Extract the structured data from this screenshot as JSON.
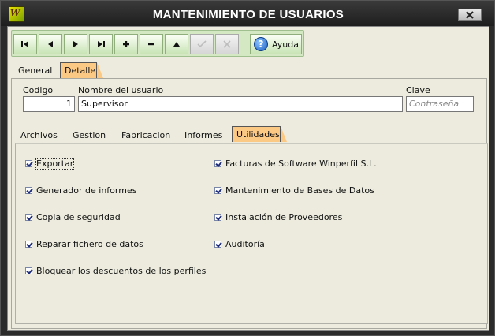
{
  "window": {
    "title": "MANTENIMIENTO DE USUARIOS",
    "app_icon_text": "W"
  },
  "toolbar": {
    "ayuda_label": "Ayuda"
  },
  "main_tabs": [
    {
      "label": "General",
      "active": false
    },
    {
      "label": "Detalle",
      "active": true
    }
  ],
  "form": {
    "codigo_label": "Codigo",
    "codigo_value": "1",
    "nombre_label": "Nombre del usuario",
    "nombre_value": "Supervisor",
    "clave_label": "Clave",
    "clave_placeholder": "Contraseña"
  },
  "sub_tabs": [
    {
      "label": "Archivos",
      "active": false
    },
    {
      "label": "Gestion",
      "active": false
    },
    {
      "label": "Fabricacion",
      "active": false
    },
    {
      "label": "Informes",
      "active": false
    },
    {
      "label": "Utilidades",
      "active": true
    }
  ],
  "permissions_left": [
    {
      "label": "Exportar",
      "checked": true
    },
    {
      "label": "Generador de informes",
      "checked": true
    },
    {
      "label": "Copia de seguridad",
      "checked": true
    },
    {
      "label": "Reparar fichero de datos",
      "checked": true
    },
    {
      "label": "Bloquear los descuentos de los perfiles",
      "checked": true
    }
  ],
  "permissions_right": [
    {
      "label": "Facturas de Software Winperfil S.L.",
      "checked": true
    },
    {
      "label": "Mantenimiento de Bases de Datos",
      "checked": true
    },
    {
      "label": "Instalación de Proveedores",
      "checked": true
    },
    {
      "label": "Auditoría",
      "checked": true
    }
  ],
  "colors": {
    "active_tab": "#fcc985",
    "toolbar_bg": "#d4e8c4",
    "client_bg": "#ecebde",
    "titlebar": "#2a2a2a"
  }
}
